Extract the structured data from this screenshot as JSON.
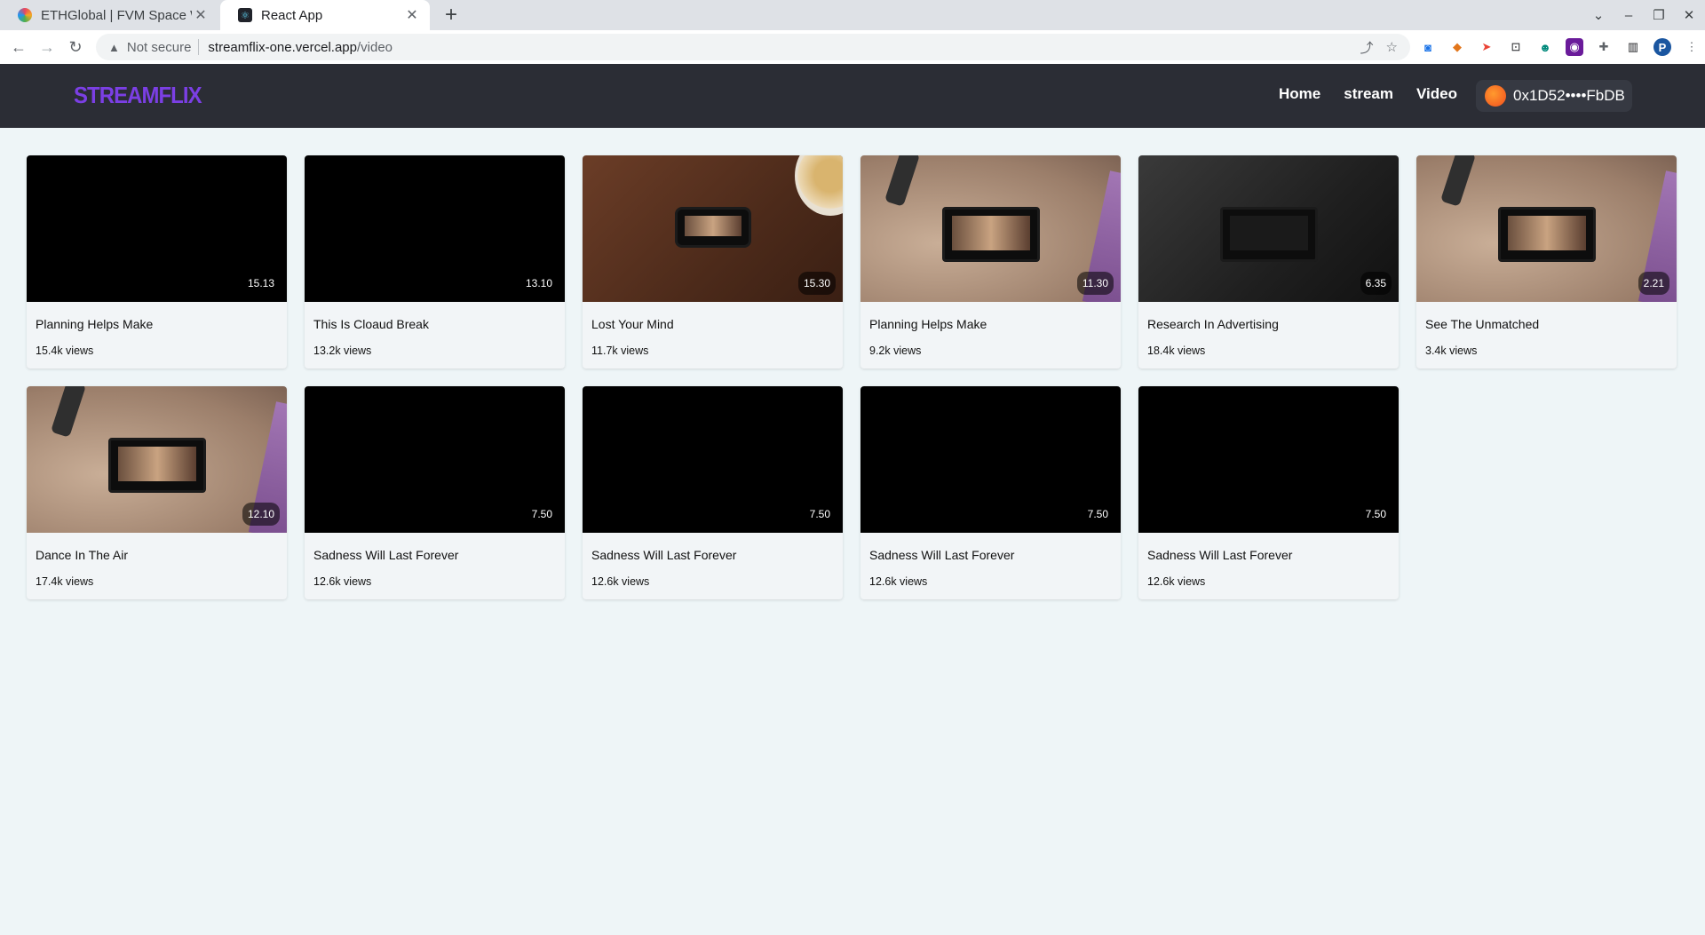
{
  "browser": {
    "tabs": [
      {
        "title": "ETHGlobal | FVM Space W",
        "active": false
      },
      {
        "title": "React App",
        "active": true
      }
    ],
    "new_tab_icon": "+",
    "url_warning": "Not secure",
    "url_host": "streamflix-one.vercel.app",
    "url_path": "/video"
  },
  "app": {
    "logo": "STREAMFLIX",
    "nav": [
      "Home",
      "stream",
      "Video"
    ],
    "wallet": "0x1D52••••FbDB",
    "colors": {
      "header_bg": "#2b2d35",
      "logo": "#7b3fe4",
      "page_bg": "#eef5f7"
    }
  },
  "videos": [
    {
      "title": "Planning Helps Make",
      "views": "15.4k views",
      "duration": "15.13",
      "thumb": "blank"
    },
    {
      "title": "This Is Cloaud Break",
      "views": "13.2k views",
      "duration": "13.10",
      "thumb": "blank"
    },
    {
      "title": "Lost Your Mind",
      "views": "11.7k views",
      "duration": "15.30",
      "thumb": "wood"
    },
    {
      "title": "Planning Helps Make",
      "views": "9.2k views",
      "duration": "11.30",
      "thumb": "bed"
    },
    {
      "title": "Research In Advertising",
      "views": "18.4k views",
      "duration": "6.35",
      "thumb": "dark"
    },
    {
      "title": "See The Unmatched",
      "views": "3.4k views",
      "duration": "2.21",
      "thumb": "bed"
    },
    {
      "title": "Dance In The Air",
      "views": "17.4k views",
      "duration": "12.10",
      "thumb": "bed"
    },
    {
      "title": "Sadness Will Last Forever",
      "views": "12.6k views",
      "duration": "7.50",
      "thumb": "blank"
    },
    {
      "title": "Sadness Will Last Forever",
      "views": "12.6k views",
      "duration": "7.50",
      "thumb": "blank"
    },
    {
      "title": "Sadness Will Last Forever",
      "views": "12.6k views",
      "duration": "7.50",
      "thumb": "blank"
    },
    {
      "title": "Sadness Will Last Forever",
      "views": "12.6k views",
      "duration": "7.50",
      "thumb": "blank"
    }
  ]
}
